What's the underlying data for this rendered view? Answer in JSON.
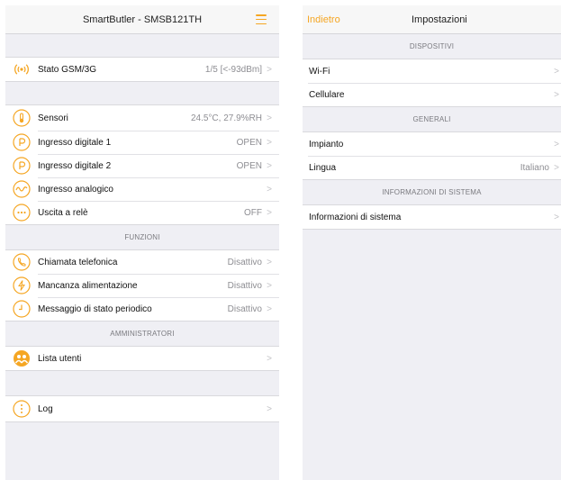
{
  "left": {
    "title": "SmartButler - SMSB121TH",
    "gsm": {
      "label": "Stato GSM/3G",
      "value": "1/5 [<-93dBm]"
    },
    "io": [
      {
        "name": "sensors",
        "icon": "thermometer-icon",
        "label": "Sensori",
        "value": "24.5°C, 27.9%RH"
      },
      {
        "name": "digital-input-1",
        "icon": "digital-input-icon",
        "label": "Ingresso digitale 1",
        "value": "OPEN"
      },
      {
        "name": "digital-input-2",
        "icon": "digital-input-icon",
        "label": "Ingresso digitale 2",
        "value": "OPEN"
      },
      {
        "name": "analog-input",
        "icon": "wave-icon",
        "label": "Ingresso analogico",
        "value": ""
      },
      {
        "name": "relay-output",
        "icon": "relay-icon",
        "label": "Uscita a relè",
        "value": "OFF"
      }
    ],
    "functions_header": "FUNZIONI",
    "functions": [
      {
        "name": "phone-call",
        "icon": "phone-icon",
        "label": "Chiamata telefonica",
        "value": "Disattivo"
      },
      {
        "name": "power-failure",
        "icon": "lightning-icon",
        "label": "Mancanza alimentazione",
        "value": "Disattivo"
      },
      {
        "name": "periodic-status",
        "icon": "clock-icon",
        "label": "Messaggio di stato periodico",
        "value": "Disattivo"
      }
    ],
    "admins_header": "AMMINISTRATORI",
    "user_list_label": "Lista utenti",
    "log_label": "Log"
  },
  "right": {
    "back_label": "Indietro",
    "title": "Impostazioni",
    "devices_header": "DISPOSITIVI",
    "devices": [
      {
        "name": "wifi",
        "label": "Wi-Fi",
        "value": ""
      },
      {
        "name": "cellular",
        "label": "Cellulare",
        "value": ""
      }
    ],
    "general_header": "GENERALI",
    "general": [
      {
        "name": "system",
        "label": "Impianto",
        "value": ""
      },
      {
        "name": "language",
        "label": "Lingua",
        "value": "Italiano"
      }
    ],
    "sysinfo_header": "INFORMAZIONI DI SISTEMA",
    "sysinfo_label": "Informazioni di sistema"
  },
  "colors": {
    "accent": "#f5a623",
    "background": "#efeff4",
    "separator": "#d9d9dd",
    "secondary_text": "#8e8e93"
  }
}
